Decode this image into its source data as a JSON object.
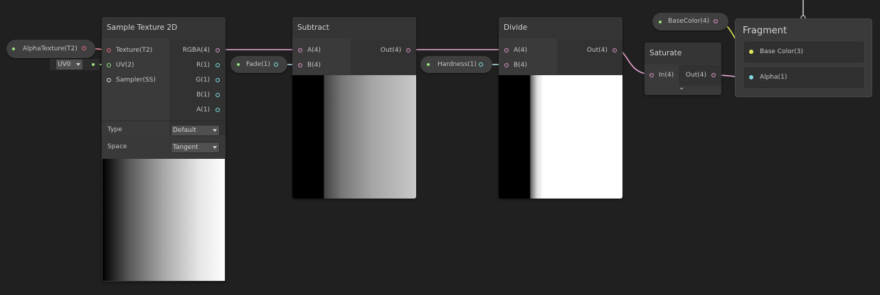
{
  "sample_texture": {
    "title": "Sample Texture 2D",
    "inputs": [
      "Texture(T2)",
      "UV(2)",
      "Sampler(SS)"
    ],
    "outputs": [
      "RGBA(4)",
      "R(1)",
      "G(1)",
      "B(1)",
      "A(1)"
    ],
    "type_label": "Type",
    "type_value": "Default",
    "space_label": "Space",
    "space_value": "Tangent"
  },
  "alpha_texture": {
    "label": "AlphaTexture(T2)"
  },
  "uv_dropdown": {
    "value": "UV0"
  },
  "fade": {
    "label": "Fade(1)"
  },
  "subtract": {
    "title": "Subtract",
    "inputs": [
      "A(4)",
      "B(4)"
    ],
    "output": "Out(4)"
  },
  "hardness": {
    "label": "Hardness(1)"
  },
  "divide": {
    "title": "Divide",
    "inputs": [
      "A(4)",
      "B(4)"
    ],
    "output": "Out(4)"
  },
  "saturate": {
    "title": "Saturate",
    "input": "In(4)",
    "output": "Out(4)",
    "expand_glyph": "⌄"
  },
  "base_color_prop": {
    "label": "BaseColor(4)"
  },
  "fragment": {
    "title": "Fragment",
    "slots": [
      "Base Color(3)",
      "Alpha(1)"
    ]
  },
  "colors": {
    "background": "#202020",
    "vector4_wire": "#e7a6d4",
    "float_wire": "#b9e6f0",
    "vector3_wire": "#dfe75a"
  }
}
